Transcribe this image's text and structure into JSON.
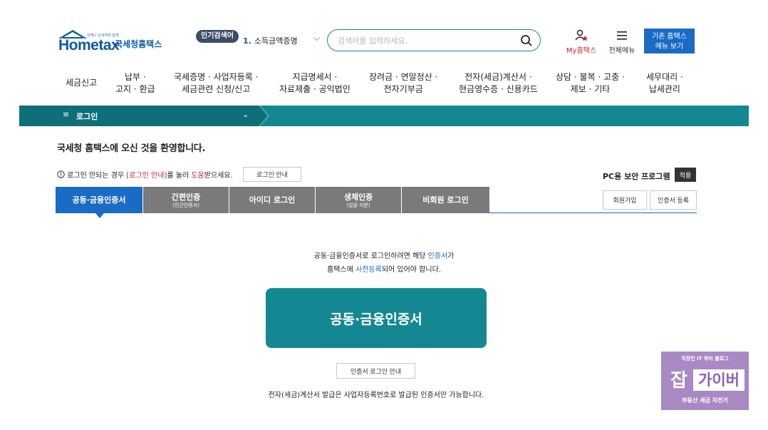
{
  "header": {
    "logo_word": "Hometax",
    "logo_small": "언제나 납세자와 함께",
    "logo_name": "국세청홈택스",
    "popular_badge": "인기검색어",
    "popular_rank": "1.",
    "popular_term": "소득금액증명",
    "search_placeholder": "검색어를 입력하세요.",
    "my_hometax": "My홈택스",
    "all_menu": "전체메뉴",
    "old_menu_line1": "기존 홈택스",
    "old_menu_line2": "메뉴 보기",
    "accent_color": "#138892",
    "brand_blue": "#1a6bc4"
  },
  "nav": {
    "items": [
      {
        "label": "세금신고"
      },
      {
        "label": "납부 ·\n고지 · 환급"
      },
      {
        "label": "국세증명 · 사업자등록 ·\n세금관련 신청/신고"
      },
      {
        "label": "지급명세서 ·\n자료제출 · 공익법인"
      },
      {
        "label": "장려금 · 연말정산 ·\n전자기부금"
      },
      {
        "label": "전자(세금)계산서 ·\n현금영수증 · 신용카드"
      },
      {
        "label": "상담 · 불복 · 고충 ·\n제보 · 기타"
      },
      {
        "label": "세무대리 ·\n납세관리"
      }
    ]
  },
  "breadcrumb": {
    "icon": "≡",
    "label": "로그인",
    "chevron": "⌄"
  },
  "main": {
    "welcome": "국세청 홈택스에 오신 것을 환영합니다.",
    "help_prefix": "로그인 안되는 경우 ",
    "help_link1": "[로그인 안내]",
    "help_mid": "를 눌러 ",
    "help_link2": "도움",
    "help_suffix": "받으세요.",
    "help_button": "로그인 안내",
    "pc_security": "PC용 보안 프로그램",
    "apply_button": "적용",
    "join_button": "회원가입",
    "cert_register_button": "인증서 등록",
    "tabs": [
      {
        "label": "공동·금융인증서",
        "sub": ""
      },
      {
        "label": "간편인증",
        "sub": "(민간인증서)"
      },
      {
        "label": "아이디 로그인",
        "sub": ""
      },
      {
        "label": "생체인증",
        "sub": "(얼굴·지문)"
      },
      {
        "label": "비회원 로그인",
        "sub": ""
      }
    ],
    "info_line1_a": "공동·금융인증서로 로그인하려면 해당 ",
    "info_line1_link": "인증서",
    "info_line1_b": "가",
    "info_line2_a": "홈택스에 ",
    "info_line2_link": "사전등록",
    "info_line2_b": "되어 있어야 합니다.",
    "cert_button": "공동·금융인증서",
    "cert_guide_button": "인증서 로그인 안내",
    "tax_notice": "전자(세금)계산서 발급은 사업자등록번호로 발급된 인증서만 가능합니다."
  },
  "watermark": {
    "top": "직장인 IT 취미 블로그",
    "jab": "잡",
    "box": "가이버",
    "bottom": "부동산 세금 자전거"
  }
}
